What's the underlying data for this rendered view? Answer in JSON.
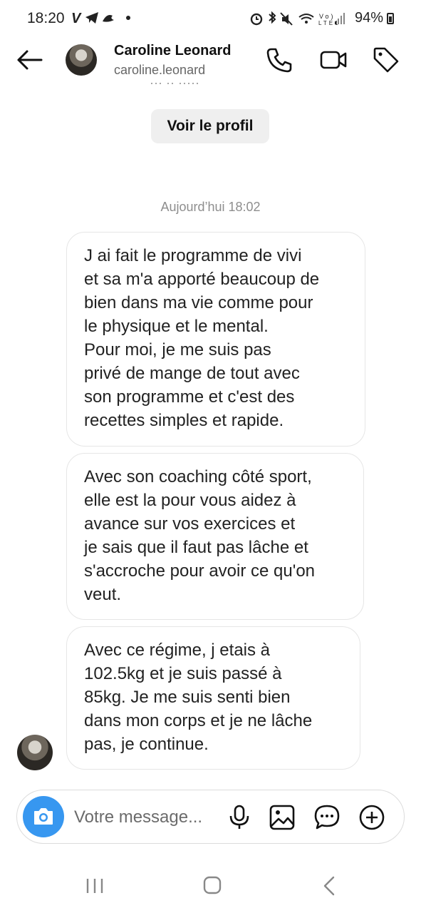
{
  "status_bar": {
    "time": "18:20",
    "battery": "94%",
    "left_icons": [
      "v-icon",
      "telegram-icon",
      "bird-icon",
      "dot-icon"
    ],
    "right_icons": [
      "alarm-icon",
      "bluetooth-icon",
      "mute-icon",
      "wifi-icon",
      "volte-icon",
      "signal-icon",
      "battery-icon"
    ]
  },
  "header": {
    "name": "Caroline Leonard",
    "username": "caroline.leonard",
    "actions": [
      "phone-icon",
      "video-icon",
      "tag-icon"
    ]
  },
  "profile_button_label": "Voir le profil",
  "timestamp": "Aujourd’hui 18:02",
  "messages": [
    {
      "text": "J ai fait le programme de vivi\net sa m'a apporté beaucoup de\nbien dans ma vie comme pour\nle physique et le mental.\nPour moi, je me suis pas\nprivé de mange de tout avec\nson programme et c'est des\nrecettes simples et rapide."
    },
    {
      "text": "Avec son coaching côté sport,\nelle est la pour vous aidez à\navance sur vos exercices et\nje sais que il faut pas lâche et\ns'accroche pour avoir ce qu'on\nveut."
    },
    {
      "text": "Avec ce régime, j etais à\n102.5kg et je suis passé à\n85kg. Je me suis senti bien\ndans mon corps et je ne lâche\npas, je continue."
    }
  ],
  "composer": {
    "placeholder": "Votre message..."
  },
  "colors": {
    "accent": "#3797f0",
    "bubble_border": "#e6e6e6",
    "button_bg": "#efefef"
  }
}
